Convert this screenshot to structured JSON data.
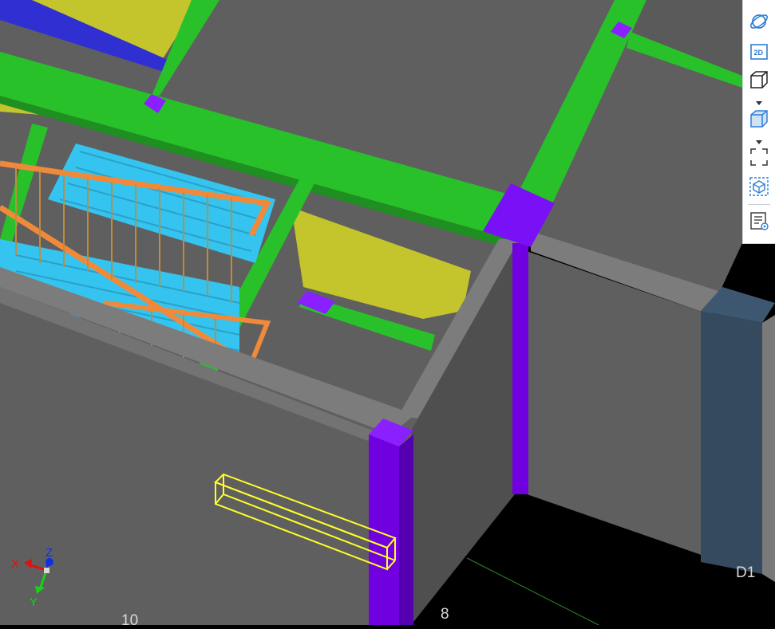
{
  "toolbar": {
    "buttons": [
      {
        "id": "orbit",
        "icon": "orbit-icon"
      },
      {
        "id": "view-2d",
        "icon": "2d-view-icon",
        "label": "2D"
      },
      {
        "id": "view-cube-wire",
        "icon": "wireframe-cube-icon"
      },
      {
        "id": "view-cube-solid",
        "icon": "shaded-cube-icon"
      },
      {
        "id": "fit-window",
        "icon": "fit-window-icon"
      },
      {
        "id": "section-box",
        "icon": "section-box-icon"
      },
      {
        "id": "properties",
        "icon": "properties-list-icon"
      }
    ]
  },
  "axes": {
    "x_label": "X",
    "y_label": "Y",
    "z_label": "Z"
  },
  "grid_labels": {
    "left": "10",
    "center": "8",
    "right": "D1"
  },
  "colors": {
    "beam_green": "#28c12a",
    "slab_yellow": "#c4c42c",
    "stair_cyan": "#35c4ef",
    "railing_orange": "#f08a3a",
    "column_purple": "#7000e0",
    "wall_gray": "#5f5f5f",
    "wall_top": "#7c7c7c",
    "wall_blue": "#354a5e",
    "selection_yellow": "#ffff28",
    "strip_blue": "#2f2fd2"
  }
}
